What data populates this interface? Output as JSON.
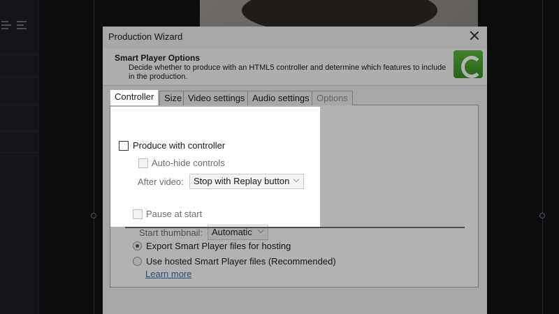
{
  "dialog": {
    "title": "Production Wizard",
    "heading": "Smart Player Options",
    "description": "Decide whether to produce with an HTML5 controller and determine which features to include in the production."
  },
  "tabs": [
    {
      "label": "Controller",
      "state": "active"
    },
    {
      "label": "Size",
      "state": "normal"
    },
    {
      "label": "Video settings",
      "state": "normal"
    },
    {
      "label": "Audio settings",
      "state": "normal"
    },
    {
      "label": "Options",
      "state": "disabled"
    }
  ],
  "controller": {
    "produce_with_controller": {
      "label": "Produce with controller",
      "checked": false
    },
    "auto_hide_controls": {
      "label": "Auto-hide controls",
      "checked": false,
      "enabled": false
    },
    "after_video": {
      "label": "After video:",
      "value": "Stop with Replay button"
    },
    "pause_at_start": {
      "label": "Pause at start",
      "checked": false,
      "enabled": false
    },
    "start_thumbnail": {
      "label": "Start thumbnail:",
      "value": "Automatic"
    }
  },
  "hosting": {
    "export_option": {
      "label": "Export Smart Player files for hosting",
      "selected": true
    },
    "hosted_option": {
      "label": "Use hosted Smart Player files (Recommended)",
      "selected": false
    },
    "learn_more": "Learn more"
  },
  "colors": {
    "accent_logo": "#4ea42f",
    "link": "#3b6fb0"
  },
  "icons": {
    "close": "close-icon",
    "logo": "camtasia-logo-icon"
  }
}
